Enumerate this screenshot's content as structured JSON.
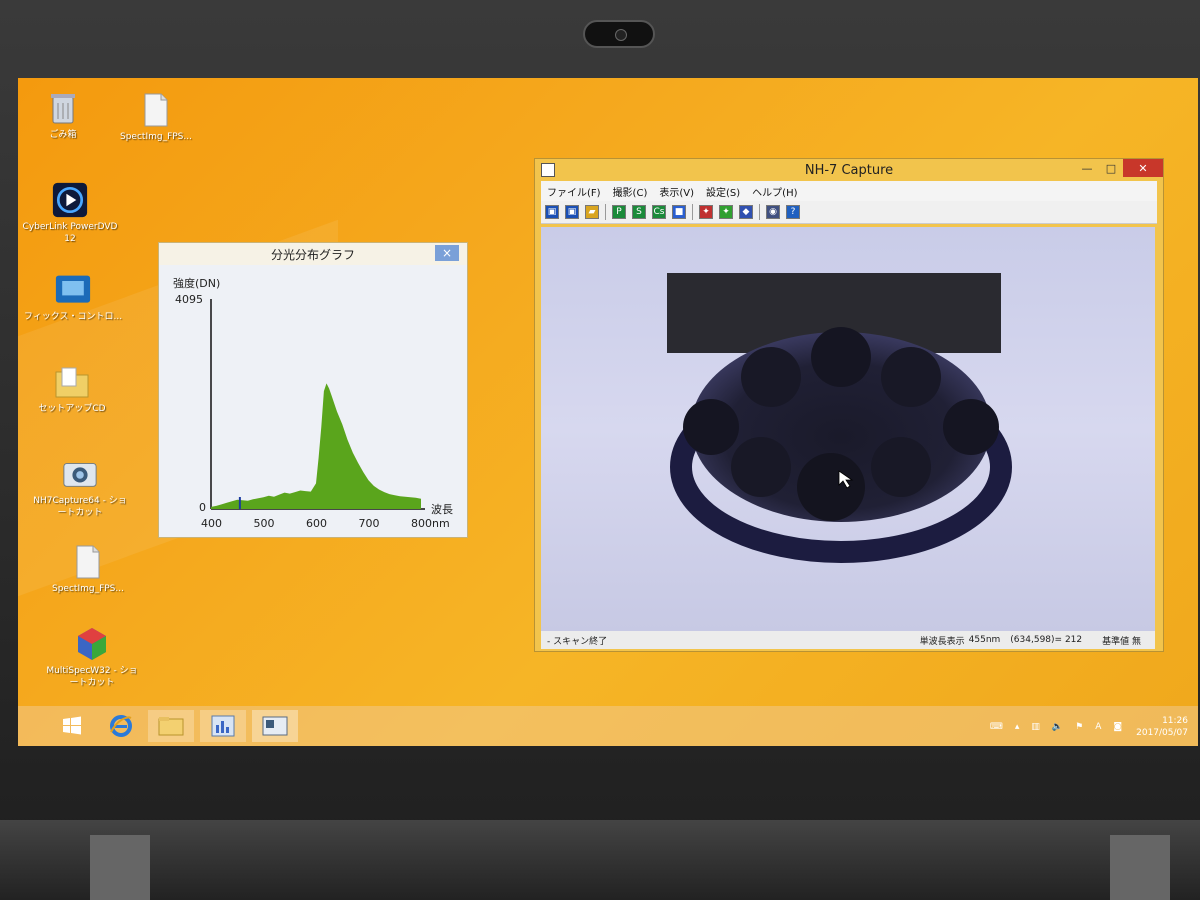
{
  "desktop": {
    "icons": [
      {
        "label": "ごみ箱",
        "icon": "recycle-bin-icon"
      },
      {
        "label": "SpectImg_FPS...",
        "icon": "file-icon"
      },
      {
        "label": "CyberLink PowerDVD 12",
        "icon": "powerdvd-icon"
      },
      {
        "label": "フィックス・コントロ...",
        "icon": "app-icon"
      },
      {
        "label": "セットアップCD",
        "icon": "folder-icon"
      },
      {
        "label": "NH7Capture64 - ショートカット",
        "icon": "camera-icon"
      },
      {
        "label": "SpectImg_FPS...",
        "icon": "file-icon"
      },
      {
        "label": "MultiSpecW32 - ショートカット",
        "icon": "cube-icon"
      }
    ]
  },
  "spectrum_window": {
    "title": "分光分布グラフ",
    "close": "×",
    "chart_data": {
      "type": "area",
      "ylabel": "強度(DN)",
      "xlabel": "波長",
      "y_top_label": "4095",
      "y_zero_label": "0",
      "x_ticks": [
        "400",
        "500",
        "600",
        "700",
        "800nm"
      ],
      "xlim": [
        400,
        800
      ],
      "ylim": [
        0,
        4095
      ],
      "color": "#5aa51c",
      "marker_wavelength": 455,
      "x": [
        400,
        410,
        420,
        430,
        440,
        450,
        460,
        470,
        480,
        490,
        500,
        510,
        520,
        530,
        540,
        550,
        560,
        570,
        580,
        590,
        600,
        605,
        610,
        615,
        620,
        625,
        630,
        640,
        650,
        660,
        670,
        680,
        690,
        700,
        710,
        720,
        730,
        740,
        750,
        760,
        770,
        780,
        790,
        800
      ],
      "values": [
        40,
        60,
        90,
        120,
        150,
        180,
        170,
        160,
        190,
        210,
        230,
        260,
        240,
        280,
        320,
        300,
        330,
        360,
        350,
        340,
        500,
        1000,
        1600,
        2300,
        2450,
        2350,
        2200,
        1900,
        1650,
        1350,
        1100,
        900,
        720,
        560,
        450,
        380,
        330,
        290,
        270,
        250,
        240,
        230,
        220,
        200
      ]
    }
  },
  "capture_window": {
    "title": "NH-7 Capture",
    "controls": {
      "minimize": "—",
      "maximize": "□",
      "close": "✕"
    },
    "menu": [
      "ファイル(F)",
      "撮影(C)",
      "表示(V)",
      "設定(S)",
      "ヘルプ(H)"
    ],
    "toolbar": [
      {
        "name": "save-icon",
        "glyph": "▣",
        "color": "#1a4fb5"
      },
      {
        "name": "save-as-icon",
        "glyph": "▣",
        "color": "#1a4fb5"
      },
      {
        "name": "open-folder-icon",
        "glyph": "▰",
        "color": "#d9a520"
      },
      {
        "name": "p-button-icon",
        "glyph": "P",
        "color": "#1b8a3a"
      },
      {
        "name": "s-button-icon",
        "glyph": "S",
        "color": "#1b8a3a"
      },
      {
        "name": "cs-button-icon",
        "glyph": "Cs",
        "color": "#1b8a3a"
      },
      {
        "name": "blue-square-icon",
        "glyph": "■",
        "color": "#2a5fd0"
      },
      {
        "name": "rgb-icon",
        "glyph": "✦",
        "color": "#c03030"
      },
      {
        "name": "rgb-alt-icon",
        "glyph": "✦",
        "color": "#30a030"
      },
      {
        "name": "cube-icon",
        "glyph": "◆",
        "color": "#3050b0"
      },
      {
        "name": "camera-icon",
        "glyph": "◉",
        "color": "#405080"
      },
      {
        "name": "help-icon",
        "glyph": "?",
        "color": "#2060c0"
      }
    ],
    "status_left": "- スキャン終了",
    "status_mode": "単波長表示",
    "status_wavelength": "455nm",
    "status_coord": "(634,598)= 212",
    "status_ref": "基準値 無"
  },
  "taskbar": {
    "clock_time": "11:26",
    "clock_date": "2017/05/07",
    "ime": "A"
  }
}
